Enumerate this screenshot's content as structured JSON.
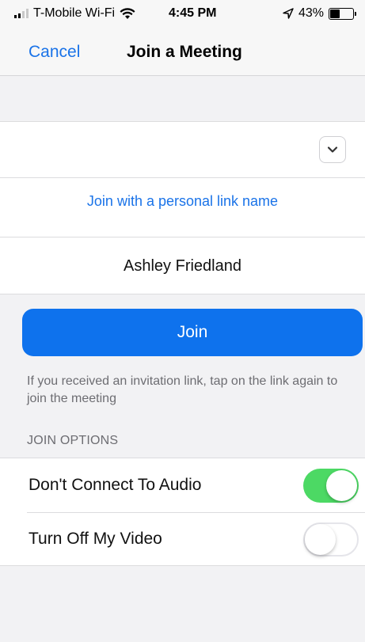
{
  "status_bar": {
    "carrier": "T-Mobile Wi-Fi",
    "time": "4:45 PM",
    "battery": "43%",
    "battery_level": 0.43,
    "icons": [
      "signal-icon",
      "wifi-icon",
      "location-arrow-icon",
      "battery-icon"
    ]
  },
  "nav": {
    "cancel_label": "Cancel",
    "title": "Join a Meeting"
  },
  "meeting": {
    "meeting_id_value": "",
    "personal_link_label": "Join with a personal link name",
    "dropdown_icon": "chevron-down-icon"
  },
  "name_field": {
    "value": "Ashley Friedland"
  },
  "join_button": {
    "label": "Join",
    "color": "#0e72ed"
  },
  "hint": "If you received an invitation link, tap on the link again to join the meeting",
  "options": {
    "header": "JOIN OPTIONS",
    "items": [
      {
        "label": "Don't Connect To Audio",
        "on": true
      },
      {
        "label": "Turn Off My Video",
        "on": false
      }
    ],
    "toggle_on_color": "#4cd964"
  }
}
